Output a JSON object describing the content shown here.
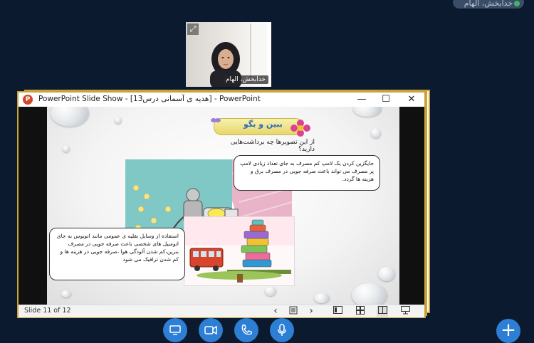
{
  "top_user_tag": "خدابخش، الهام",
  "video": {
    "name": "خدابخش، الهام"
  },
  "window": {
    "title": "PowerPoint Slide Show - [هدیه ی آسمانی درس13] - PowerPoint",
    "app_icon_letter": "P"
  },
  "slide": {
    "heading": "ببین و بگو",
    "question": "از این تصویرها چه برداشت‌هایی دارید؟",
    "callout_right": "جایگزین کردن یک لامپ کم مصرف به جای تعداد زیادی لامپ پر مصرف می تواند باعث صرفه جویی در مصرف برق و هزینه ها گردد.",
    "callout_left": "استفاده از وسایل نقلیه ی عمومی مانند اتوبوس به جای اتومبیل های شخصی باعث صرفه جویی  در مصرف بنزین،کم شدن آلودگی هوا ،صرفه جویی در هزینه ها و کم شدن ترافیک می شود"
  },
  "statusbar": {
    "slide_counter": "Slide 11 of 12"
  },
  "colors": {
    "background": "#0b1a2e",
    "accent": "#2d7fd6",
    "frame": "#c9a23a"
  },
  "icons": {
    "dock": [
      "screen-share-icon",
      "camera-icon",
      "phone-icon",
      "microphone-icon"
    ],
    "add": "plus-icon"
  }
}
